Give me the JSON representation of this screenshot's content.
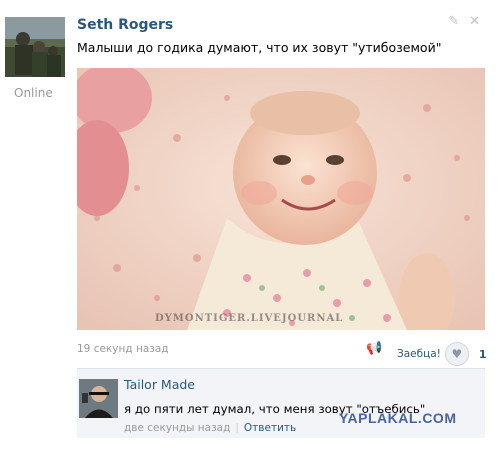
{
  "post": {
    "author": "Seth Rogers",
    "status": "Online",
    "text": "Малыши до годика думают, что их зовут \"утибоземой\"",
    "time": "19 секунд назад",
    "photo_watermark": "DYMONTIGER.LIVEJOURNAL",
    "like_label": "Заебца!",
    "like_count": "1",
    "action_icons": [
      "pencil-icon",
      "close-icon"
    ]
  },
  "comment": {
    "author": "Tailor Made",
    "text": "я до пяти лет думал, что меня зовут \"отъебись\"",
    "time": "две секунды назад",
    "separator": "|",
    "reply_label": "Ответить"
  },
  "site_watermark": "YAPLAKAL.COM",
  "colors": {
    "link": "#2b587a",
    "meta_gray": "#999999",
    "comment_bg": "#f2f4f7"
  }
}
